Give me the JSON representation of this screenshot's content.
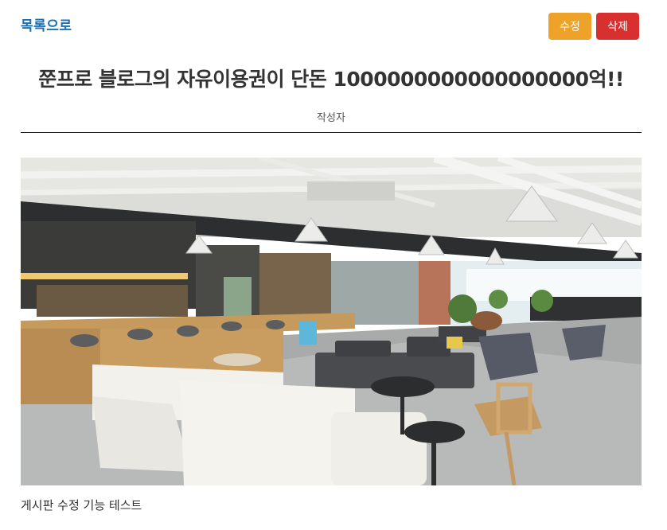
{
  "nav": {
    "back_label": "목록으로"
  },
  "actions": {
    "edit_label": "수정",
    "delete_label": "삭제"
  },
  "post": {
    "title": "쭌프로 블로그의 자유이용권이 단돈 1000000000000000000억!!",
    "author_label": "작성자",
    "body": "게시판 수정 기능 테스트"
  },
  "colors": {
    "link": "#1a6fb5",
    "edit_button": "#efa229",
    "delete_button": "#d7302e",
    "divider": "#222222"
  }
}
